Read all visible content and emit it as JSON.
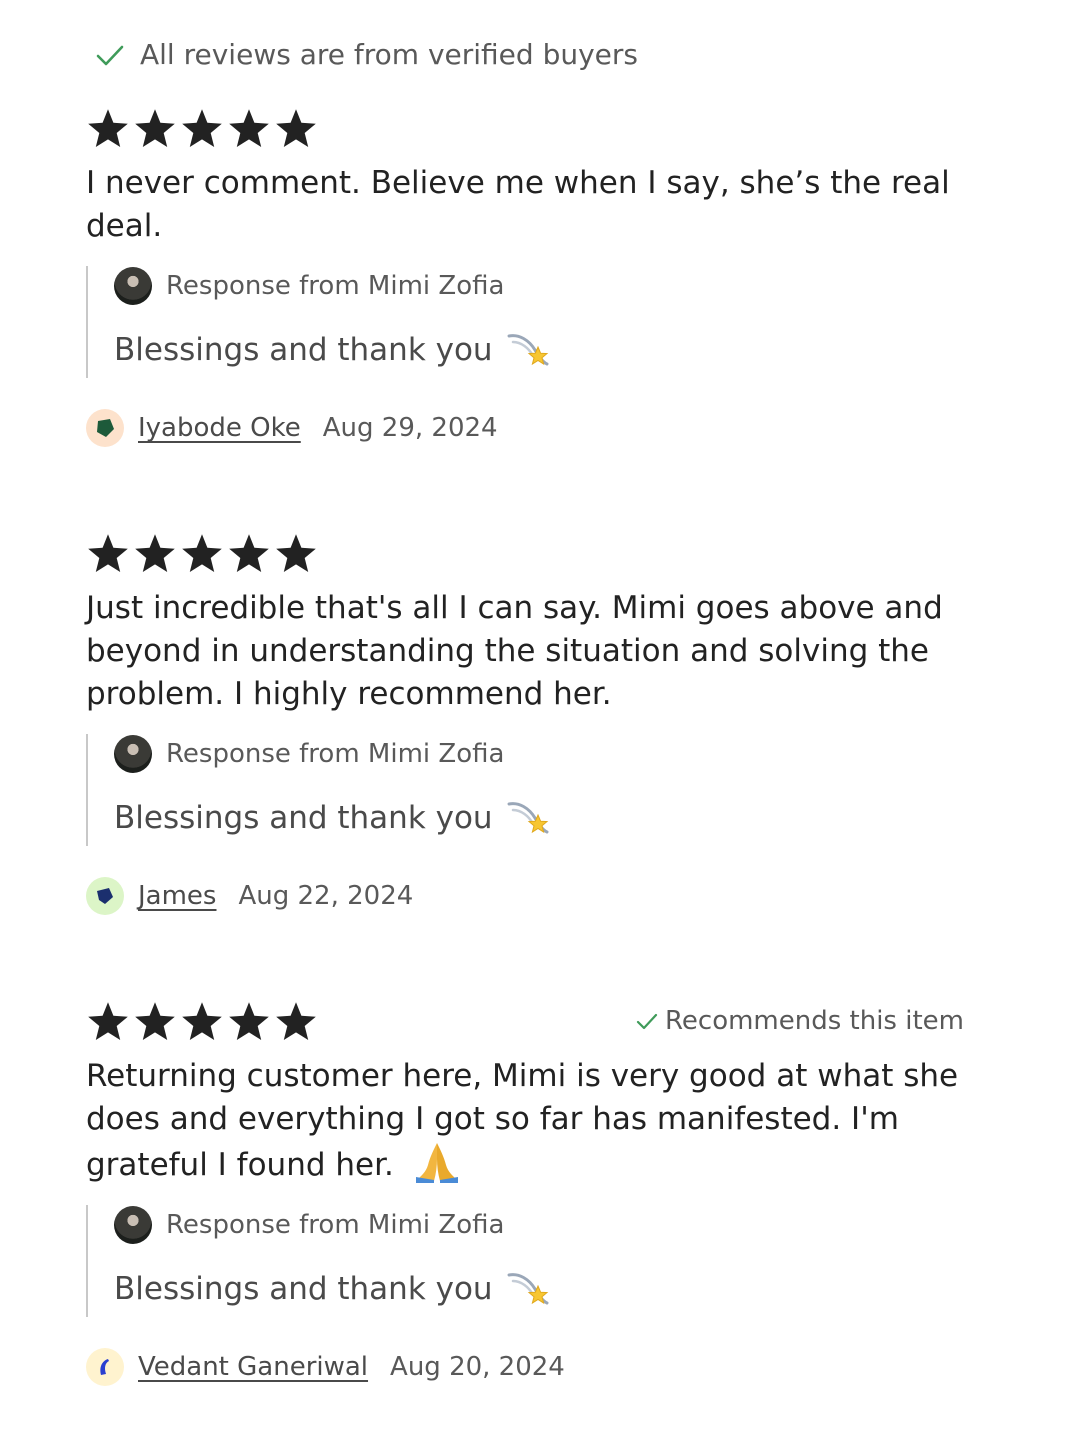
{
  "verified_notice": {
    "text": "All reviews are from verified buyers",
    "icon": "check-icon",
    "icon_color": "#3f9b5a"
  },
  "star_color": "#222222",
  "reviews": [
    {
      "rating": 5,
      "recommends": "",
      "text": "I never comment. Believe me when I say, she’s the real deal.",
      "response": {
        "from": "Response from Mimi Zofia",
        "text": "Blessings and thank you",
        "emoji": "dizzy-star-icon"
      },
      "reviewer": {
        "name": "Iyabode Oke",
        "date": "Aug 29, 2024",
        "avatar_bg": "#fde2cc",
        "avatar_fg": "#1d5a3a"
      }
    },
    {
      "rating": 5,
      "recommends": "",
      "text": "Just incredible that's all I can say. Mimi goes above and beyond in understanding the situation and solving the problem. I highly recommend her.",
      "response": {
        "from": "Response from Mimi Zofia",
        "text": "Blessings and thank you",
        "emoji": "dizzy-star-icon"
      },
      "reviewer": {
        "name": "James",
        "date": "Aug 22, 2024",
        "avatar_bg": "#dcf5c7",
        "avatar_fg": "#1b2f6e"
      }
    },
    {
      "rating": 5,
      "recommends": "Recommends this item",
      "text": "Returning customer here, Mimi is very good at what she does and everything I got so far has manifested. I'm grateful I found her.",
      "text_emoji": "folded-hands-icon",
      "response": {
        "from": "Response from Mimi Zofia",
        "text": "Blessings and thank you",
        "emoji": "dizzy-star-icon"
      },
      "reviewer": {
        "name": "Vedant Ganeriwal",
        "date": "Aug 20, 2024",
        "avatar_bg": "#fff3cf",
        "avatar_fg": "#2a3fd0"
      }
    }
  ]
}
